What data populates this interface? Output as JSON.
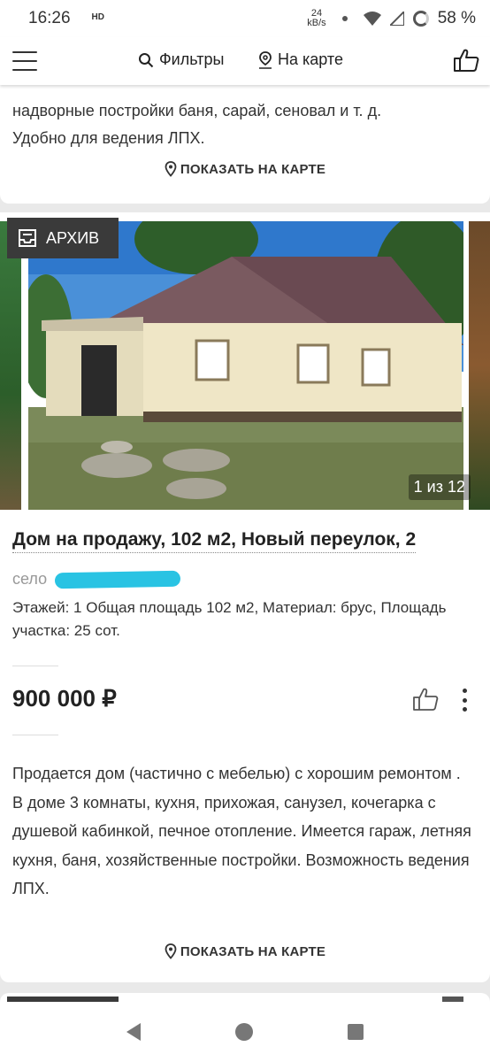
{
  "status": {
    "time": "16:26",
    "hd": "HD",
    "speed_value": "24",
    "speed_unit": "kB/s",
    "battery": "58 %"
  },
  "appbar": {
    "filters_label": "Фильтры",
    "map_label": "На карте",
    "icons": [
      "menu-icon",
      "search-icon",
      "map-pin-icon",
      "thumb-up-icon"
    ]
  },
  "prev_card": {
    "desc_line1": "надворные постройки баня, сарай, сеновал и т. д.",
    "desc_line2": "Удобно для ведения ЛПХ.",
    "show_on_map": "ПОКАЗАТЬ НА КАРТЕ"
  },
  "listing": {
    "badge": "АРХИВ",
    "photo_counter": "1 из 12",
    "title": "Дом на продажу, 102 м2, Новый переулок, 2",
    "locality": "село",
    "params": "Этажей: 1 Общая площадь 102 м2, Материал: брус, Площадь участка: 25 сот.",
    "price": "900 000 ₽",
    "description": "Продается дом (частично с мебелью) с хорошим ремонтом . В доме 3 комнаты, кухня, прихожая, санузел, кочегарка с душевой кабинкой, печное отопление. Имеется гараж, летняя кухня, баня, хозяйственные постройки. Возможность ведения ЛПХ.",
    "show_on_map": "ПОКАЗАТЬ НА КАРТЕ",
    "redaction_color": "#29c3e3"
  },
  "navbar": {
    "icons": [
      "back-icon",
      "home-icon",
      "recents-icon"
    ]
  }
}
